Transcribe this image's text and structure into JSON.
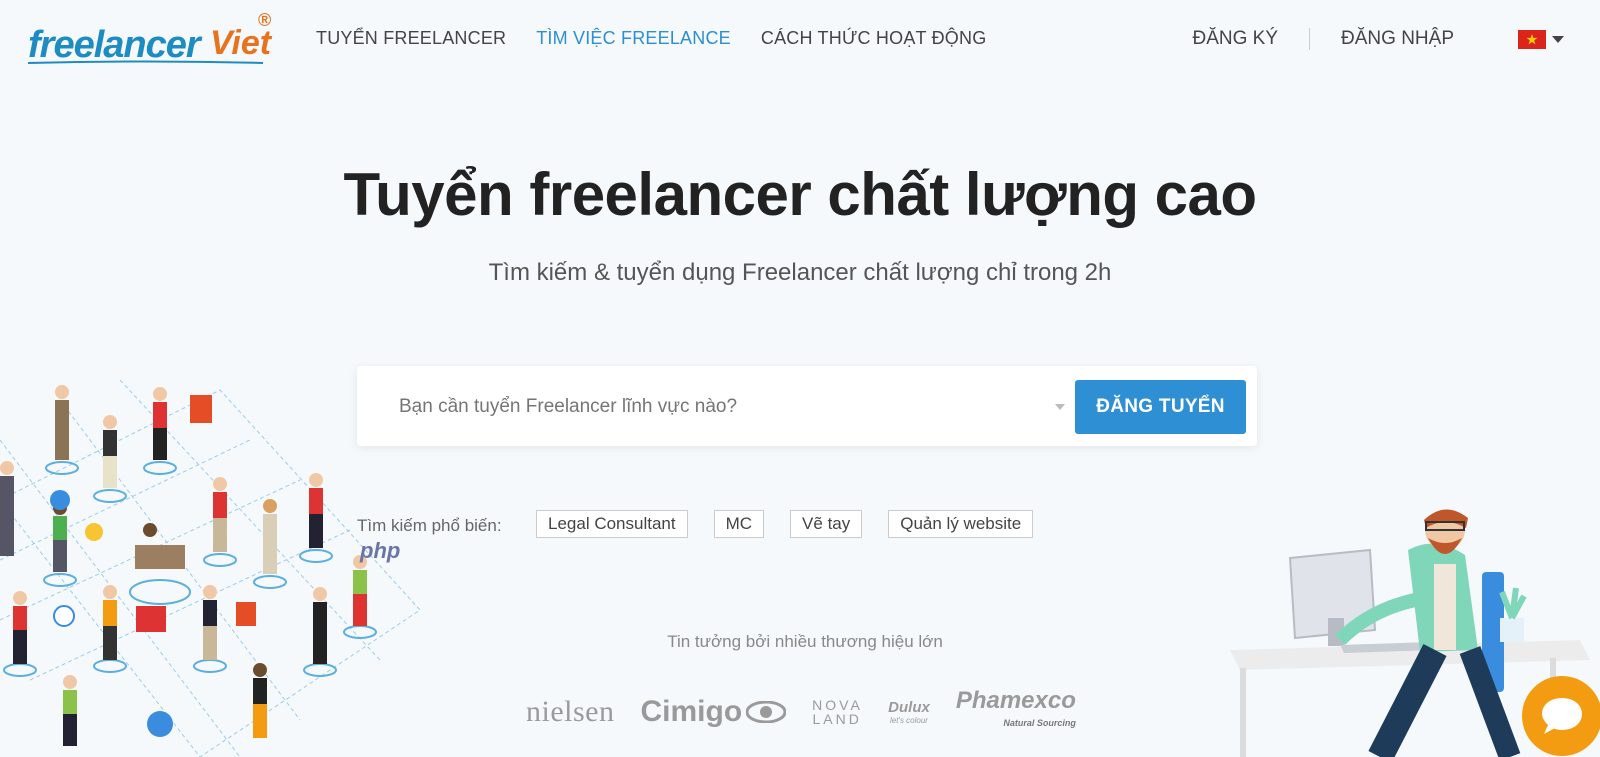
{
  "brand": {
    "logo_text": "freelancer",
    "logo_accent": "Viet",
    "registered": "®",
    "primary_color": "#2f8fd4",
    "accent_color": "#e8731f"
  },
  "nav": {
    "items": [
      {
        "label": "TUYỂN FREELANCER",
        "active": false
      },
      {
        "label": "TÌM VIỆC FREELANCE",
        "active": true
      },
      {
        "label": "CÁCH THỨC HOẠT ĐỘNG",
        "active": false
      }
    ]
  },
  "auth": {
    "register_label": "ĐĂNG KÝ",
    "login_label": "ĐĂNG NHẬP",
    "language_icon": "vietnam-flag-icon"
  },
  "hero": {
    "title": "Tuyển freelancer chất lượng cao",
    "subtitle": "Tìm kiếm & tuyển dụng Freelancer chất lượng chỉ trong 2h"
  },
  "search": {
    "placeholder": "Bạn cần tuyển Freelancer lĩnh vực nào?",
    "button_label": "ĐĂNG TUYỂN"
  },
  "popular": {
    "label": "Tìm kiếm phổ biến:",
    "tags": [
      "Legal Consultant",
      "MC",
      "Vẽ tay",
      "Quản lý website"
    ]
  },
  "illustration": {
    "php_label": "php"
  },
  "trust": {
    "label": "Tin tưởng bởi nhiều thương hiệu lớn",
    "brands": [
      "nielsen",
      "Cimigo",
      "NOVA LAND",
      "Dulux",
      "Phamexco"
    ],
    "dulux_tagline": "let's colour",
    "phamexco_tagline": "Natural Sourcing"
  },
  "chat": {
    "icon": "chat-bubble-icon",
    "color": "#f39c12"
  }
}
